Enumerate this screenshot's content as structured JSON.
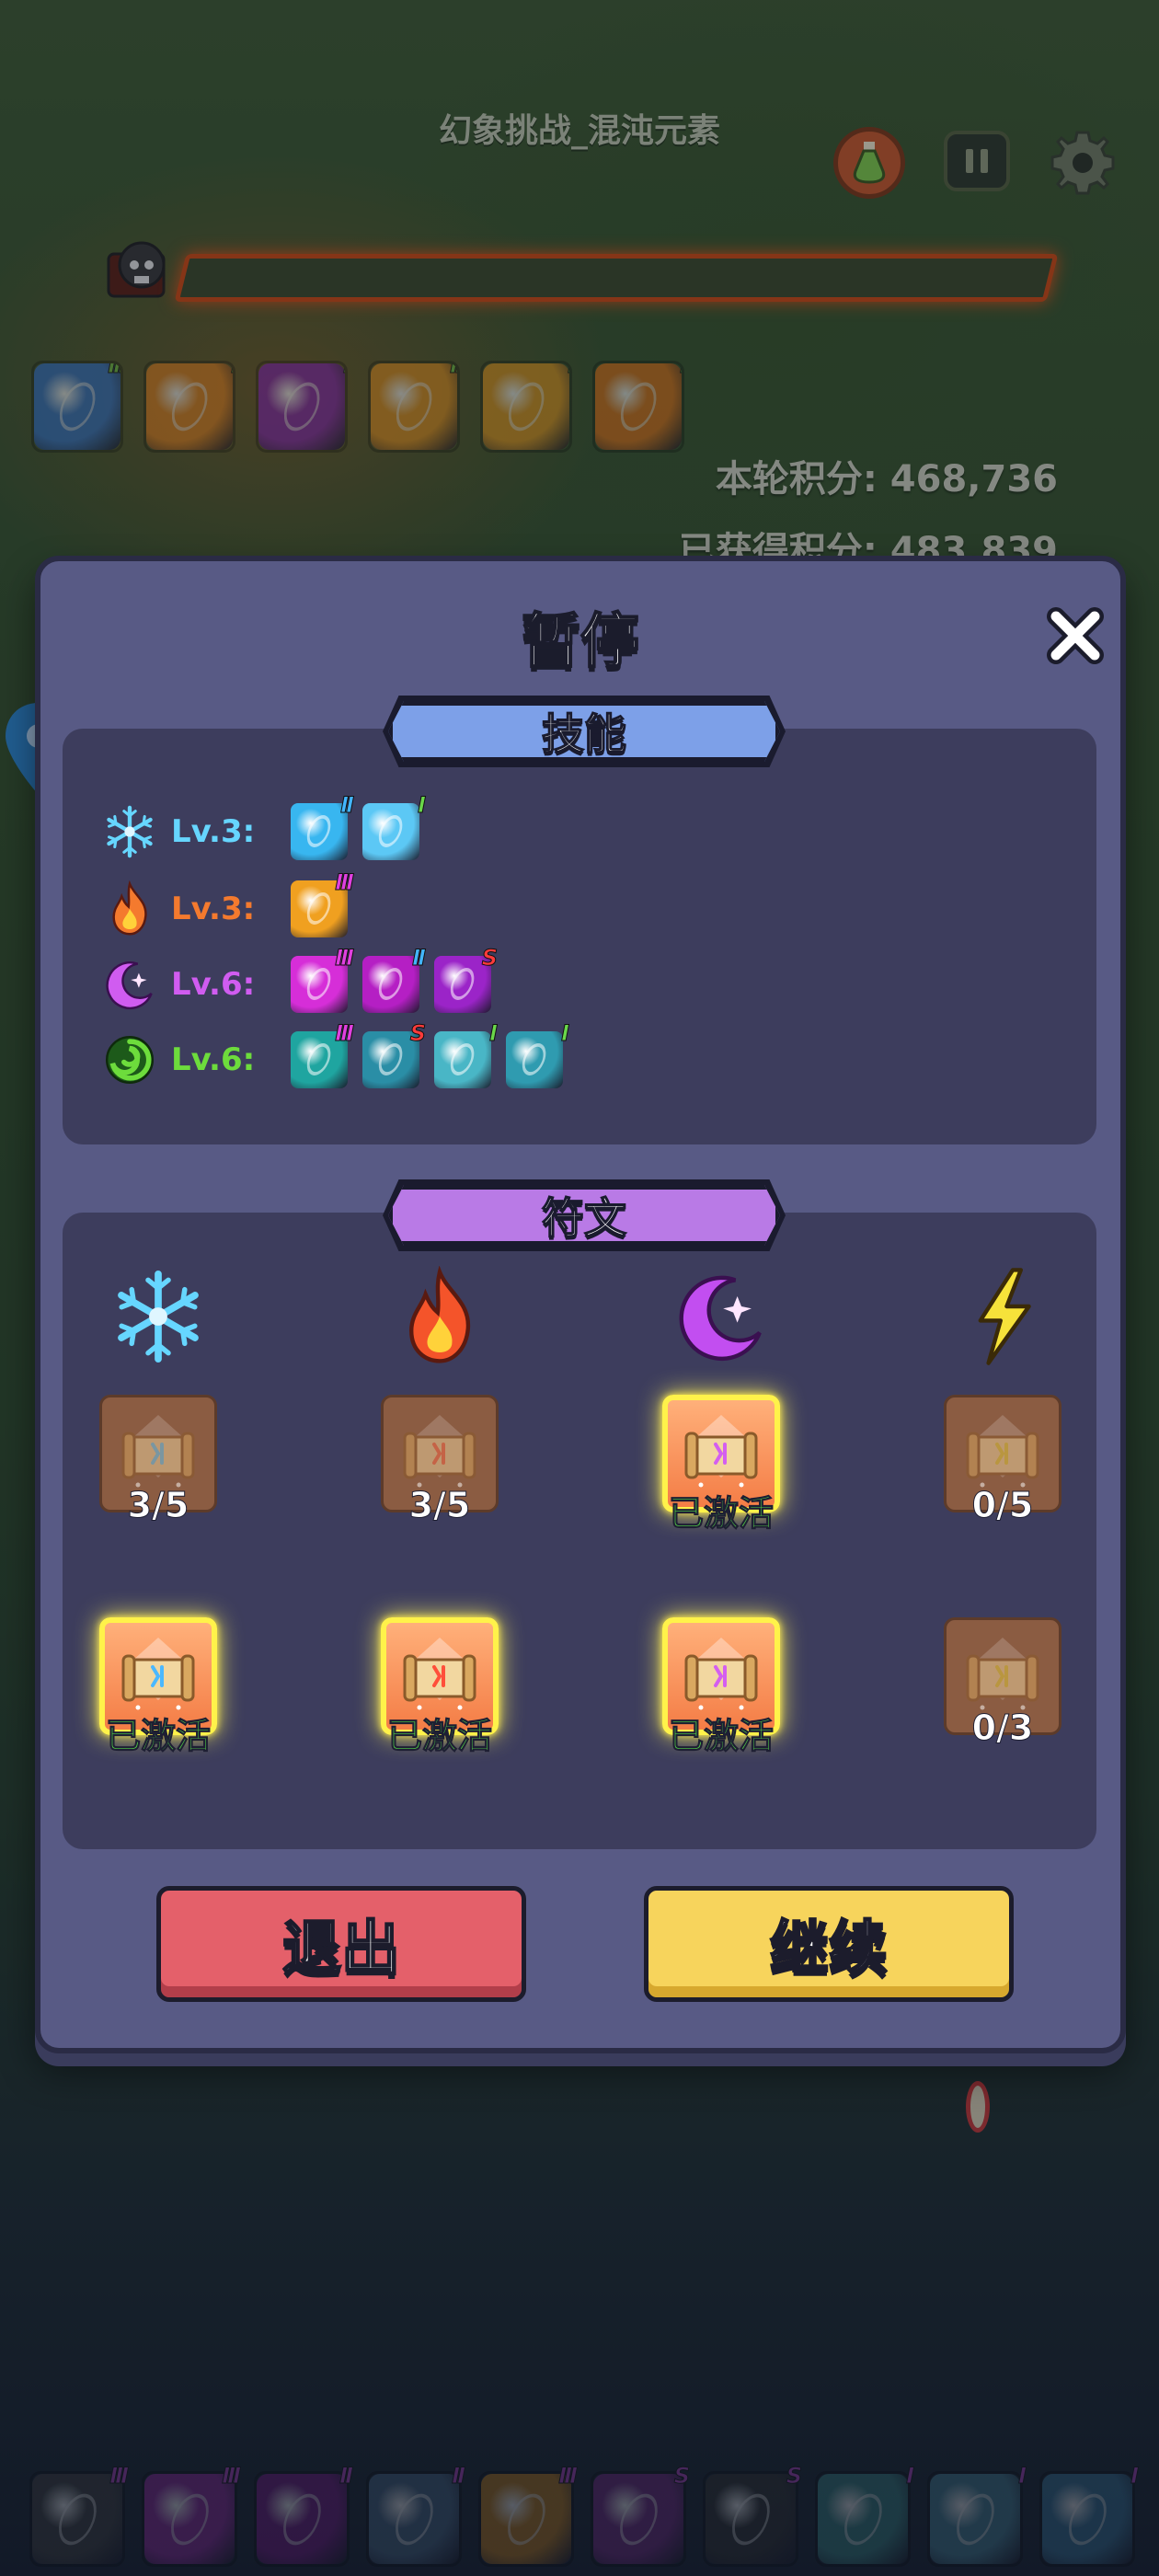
{
  "hud": {
    "level_title": "幻象挑战_混沌元素",
    "round_score": "本轮积分: 468,736",
    "total_score": "已获得积分: 483,839"
  },
  "top_skills": [
    {
      "icon": "ice-orbit-skill-icon",
      "tier": "III",
      "color": "#3a7bd5"
    },
    {
      "icon": "fire-burst-skill-icon",
      "tier": "I",
      "color": "#f08a1f"
    },
    {
      "icon": "arcane-orb-skill-icon",
      "tier": "I",
      "color": "#8e2bb3"
    },
    {
      "icon": "fire-slash-skill-icon",
      "tier": "II",
      "color": "#f19a1f"
    },
    {
      "icon": "fire-explosion-skill-icon",
      "tier": "I",
      "color": "#f0a020"
    },
    {
      "icon": "fire-meteor-skill-icon",
      "tier": "I",
      "color": "#ee7a18"
    }
  ],
  "modal": {
    "title": "暂停",
    "skills_header": "技能",
    "runes_header": "符文",
    "exit_label": "退出",
    "continue_label": "继续"
  },
  "skill_rows": [
    {
      "element": "ice",
      "icon": "snowflake-icon",
      "level": "Lv.3:",
      "color": "#66d6ff",
      "skills": [
        {
          "color": "#38b6f0",
          "tier": "II",
          "tier_color": "#43b5ff"
        },
        {
          "color": "#5cc8f5",
          "tier": "I",
          "tier_color": "#6ad84a"
        }
      ]
    },
    {
      "element": "fire",
      "icon": "flame-icon",
      "level": "Lv.3:",
      "color": "#f47a2e",
      "skills": [
        {
          "color": "#f0a020",
          "tier": "III",
          "tier_color": "#e040e0"
        }
      ]
    },
    {
      "element": "arcane",
      "icon": "crescent-moon-icon",
      "level": "Lv.6:",
      "color": "#d05cf0",
      "skills": [
        {
          "color": "#d62ed8",
          "tier": "III",
          "tier_color": "#e040e0"
        },
        {
          "color": "#b51fc4",
          "tier": "II",
          "tier_color": "#43b5ff"
        },
        {
          "color": "#9b24c8",
          "tier": "S",
          "tier_color": "#ff3b3b"
        }
      ]
    },
    {
      "element": "wind",
      "icon": "swirl-icon",
      "level": "Lv.6:",
      "color": "#6ddc3c",
      "skills": [
        {
          "color": "#1fa5a0",
          "tier": "III",
          "tier_color": "#e040e0"
        },
        {
          "color": "#2a8ea6",
          "tier": "S",
          "tier_color": "#ff3b3b"
        },
        {
          "color": "#49b6c6",
          "tier": "I",
          "tier_color": "#6ad84a"
        },
        {
          "color": "#2f9bb0",
          "tier": "I",
          "tier_color": "#6ad84a"
        }
      ]
    }
  ],
  "runes": {
    "elements": [
      {
        "icon": "snowflake-icon",
        "color": "#66d6ff"
      },
      {
        "icon": "flame-icon",
        "color": "#f4542a"
      },
      {
        "icon": "crescent-moon-icon",
        "color": "#c24ef0"
      },
      {
        "icon": "lightning-icon",
        "color": "#f6e23a"
      }
    ],
    "row1": [
      {
        "status": "3/5",
        "active": false,
        "glyph": "#6ad0ff"
      },
      {
        "status": "3/5",
        "active": false,
        "glyph": "#ff6b4a"
      },
      {
        "status": "已激活",
        "active": true,
        "glyph": "#d45ef0"
      },
      {
        "status": "0/5",
        "active": false,
        "glyph": "#e8d040"
      }
    ],
    "row2": [
      {
        "status": "已激活",
        "active": true,
        "glyph": "#4bb8ff"
      },
      {
        "status": "已激活",
        "active": true,
        "glyph": "#ff4f3a"
      },
      {
        "status": "已激活",
        "active": true,
        "glyph": "#d45ef0"
      },
      {
        "status": "0/3",
        "active": false,
        "glyph": "#e8d040"
      }
    ]
  },
  "bottom_bar": [
    {
      "icon": "shadow-blade-skill-icon",
      "tier": "III",
      "color": "#444"
    },
    {
      "icon": "arcane-burst-skill-icon",
      "tier": "III",
      "color": "#9a2aa8"
    },
    {
      "icon": "arcane-orb-skill-icon",
      "tier": "II",
      "color": "#7a1a8a"
    },
    {
      "icon": "ice-slash-skill-icon",
      "tier": "II",
      "color": "#4a6a8a"
    },
    {
      "icon": "fire-ring-skill-icon",
      "tier": "III",
      "color": "#c8821a"
    },
    {
      "icon": "arcane-claw-skill-icon",
      "tier": "S",
      "color": "#7a2a8a"
    },
    {
      "icon": "dark-orb-skill-icon",
      "tier": "S",
      "color": "#333"
    },
    {
      "icon": "wind-blade-skill-icon",
      "tier": "I",
      "color": "#3a8a8a"
    },
    {
      "icon": "wind-vortex-skill-icon",
      "tier": "I",
      "color": "#4a8aa0"
    },
    {
      "icon": "ice-shield-skill-icon",
      "tier": "I",
      "color": "#3a7aa0"
    }
  ]
}
